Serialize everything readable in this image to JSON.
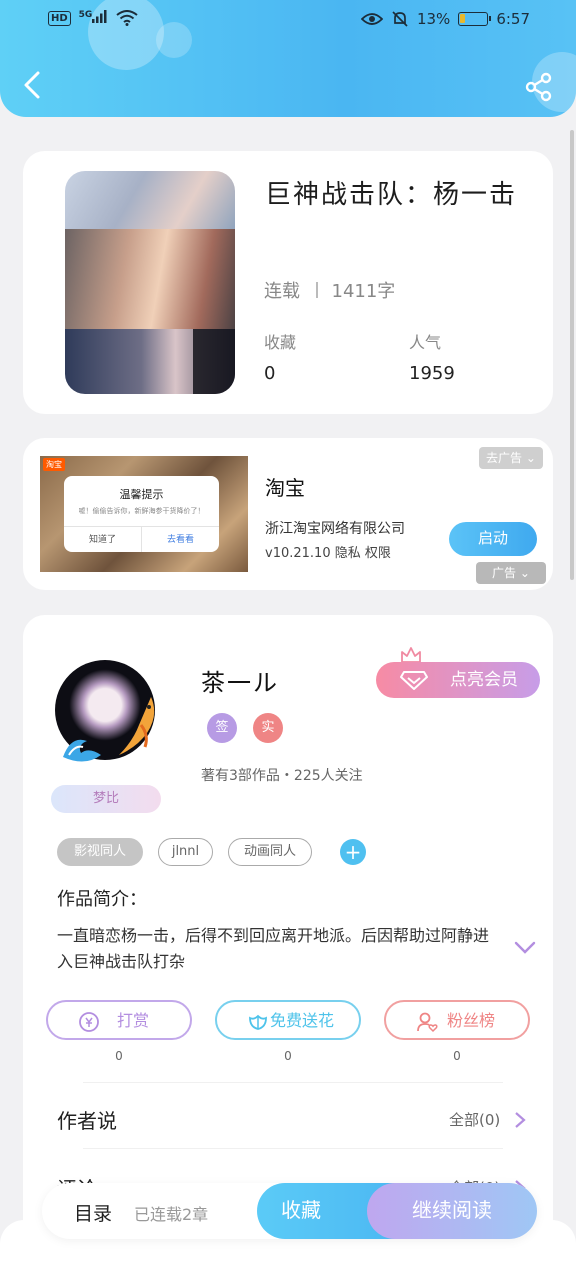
{
  "status_bar": {
    "network": "5G",
    "hd": "HD",
    "battery": "13%",
    "time": "6:57"
  },
  "header": {
    "back_icon": "back-arrow-icon",
    "share_icon": "share-icon"
  },
  "book": {
    "title": "巨神战击队：杨一击",
    "state": "连载",
    "word_count": "1411字",
    "favorites_label": "收藏",
    "favorites_value": "0",
    "popularity_label": "人气",
    "popularity_value": "1959"
  },
  "ad": {
    "tag": "淘宝",
    "dialog_title": "温馨提示",
    "dialog_message": "嘘！偷偷告诉你，新鲜海参干货降价了！",
    "dialog_cancel": "知道了",
    "dialog_confirm": "去看看",
    "brand": "淘宝",
    "company": "浙江淘宝网络有限公司",
    "version": "v10.21.10 隐私 权限",
    "launch": "启动",
    "skip": "去广告",
    "label": "广告"
  },
  "author": {
    "name": "茶一ル",
    "badge": "梦比",
    "vip_button": "点亮会员",
    "sign_badge": "签",
    "real_badge": "实",
    "works": "著有3部作品・225人关注",
    "tags": [
      "影视同人",
      "jlnnl",
      "动画同人"
    ],
    "add_tag": "+"
  },
  "intro": {
    "label": "作品简介：",
    "text": "一直暗恋杨一击，后得不到回应离开地派。后因帮助过阿静进入巨神战击队打杂"
  },
  "actions": [
    {
      "label": "打赏",
      "count": "0",
      "icon": "coin-icon",
      "color": "#b38ee0"
    },
    {
      "label": "免费送花",
      "count": "0",
      "icon": "flower-icon",
      "color": "#4ec3ea"
    },
    {
      "label": "粉丝榜",
      "count": "0",
      "icon": "fan-user-icon",
      "color": "#ef8585"
    }
  ],
  "author_says": {
    "label": "作者说",
    "right": "全部(0)"
  },
  "comments": {
    "label": "评论",
    "right": "全部(0)"
  },
  "bottom_bar": {
    "toc": "目录",
    "status": "已连载2章",
    "favorite": "收藏",
    "continue": "继续阅读"
  },
  "colors": {
    "accent_blue": "#4ab6f2",
    "vip_pink": "#f78ba4",
    "purple": "#b38ee0"
  }
}
